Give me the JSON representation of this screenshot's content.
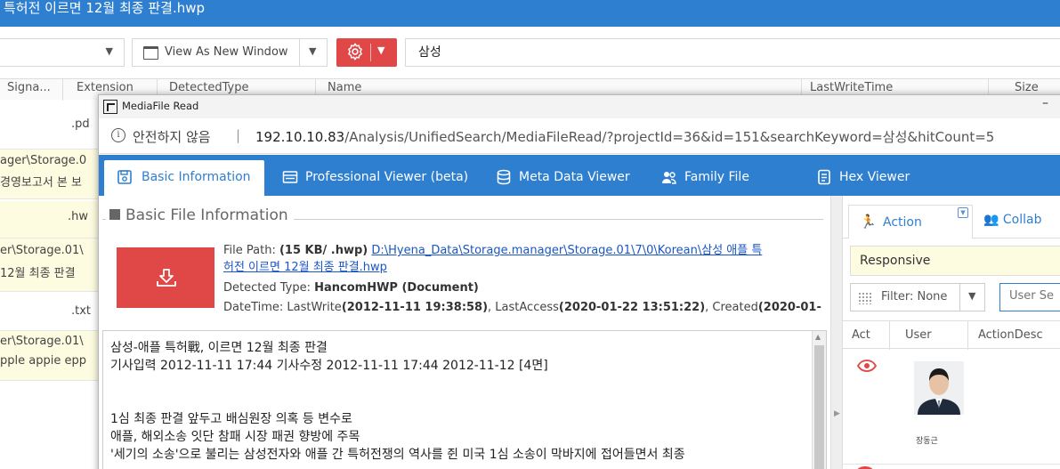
{
  "window": {
    "title_fragment": "특허전 이르면 12월 최종 판결.hwp"
  },
  "toolbar": {
    "view_button_label": "View As New Window",
    "search_value": "삼성"
  },
  "grid": {
    "columns": [
      "Signa...",
      "Extension",
      "DetectedType",
      "Name",
      "LastWriteTime",
      "Size"
    ],
    "rows": [
      {
        "ext": ".pd"
      },
      {
        "path": "ager\\Storage.0",
        "snippet": "경영보고서 본 보"
      },
      {
        "ext": ".hw"
      },
      {
        "path": "er\\Storage.01\\",
        "snippet": "12월 최종 판결"
      },
      {
        "ext": ".txt"
      },
      {
        "path": "er\\Storage.01\\",
        "snippet": "pple appie epp"
      }
    ]
  },
  "modal": {
    "title": "MediaFile Read",
    "address": {
      "warning": "안전하지 않음",
      "separator": "|",
      "host": "192.10.10.83",
      "path": "/Analysis/UnifiedSearch/MediaFileRead/?projectId=36&id=151&searchKeyword=삼성&hitCount=5"
    },
    "tabs": [
      {
        "label": "Basic Information",
        "icon": "save-icon",
        "active": true
      },
      {
        "label": "Professional Viewer (beta)",
        "icon": "viewer-icon",
        "active": false
      },
      {
        "label": "Meta Data Viewer",
        "icon": "database-icon",
        "active": false
      },
      {
        "label": "Family File",
        "icon": "family-icon",
        "active": false
      },
      {
        "label": "Hex Viewer",
        "icon": "hex-icon",
        "active": false
      }
    ],
    "basic": {
      "legend": "Basic File Information",
      "file_path_label": "File Path: ",
      "file_size": "(15 KB/ .hwp)",
      "file_path_link_line1": "D:\\Hyena_Data\\Storage.manager\\Storage.01\\7\\0\\Korean\\삼성 애플 특",
      "file_path_link_line2": "허전 이르면 12월 최종 판결.hwp",
      "detected_type_label": "Detected Type: ",
      "detected_type_value": "HancomHWP (Document)",
      "datetime_label": "DateTime: LastWrite",
      "last_write": "(2012-11-11 19:38:58)",
      "last_access_label": ", LastAccess",
      "last_access": "(2020-01-22 13:51:22)",
      "created_label": ", Created",
      "created": "(2020-01-"
    },
    "content_lines": [
      "삼성-애플 특허戰, 이르면 12월 최종 판결",
      "기사입력 2012-11-11 17:44 기사수정 2012-11-11 17:44 2012-11-12 [4면]",
      "",
      "",
      "1심 최종 판결 앞두고 배심원장 의혹 등 변수로",
      "애플, 해외소송 잇단 참패 시장 패권 향방에 주목",
      "'세기의 소송'으로 불리는 삼성전자와 애플 간 특허전쟁의 역사를 쥔 미국 1심 소송이 막바지에 접어들면서 최종"
    ],
    "side": {
      "tab_action": "Action",
      "tab_collab": "Collab",
      "responsive": "Responsive",
      "filter_label": "Filter: None",
      "user_search_placeholder": "User Se",
      "columns": [
        "Act",
        "User",
        "ActionDesc"
      ],
      "rows": [
        {
          "user_name": "장동근"
        }
      ]
    }
  },
  "colors": {
    "accent": "#2e7fd0",
    "danger": "#e04848",
    "highlight": "#fdfbe0"
  }
}
